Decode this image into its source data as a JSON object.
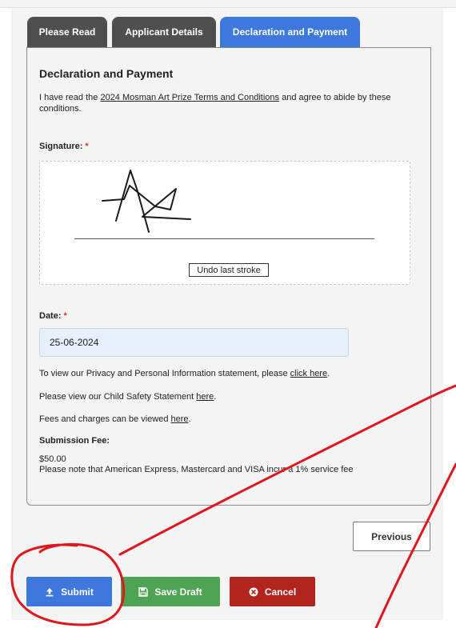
{
  "tabs": [
    {
      "label": "Please Read"
    },
    {
      "label": "Applicant Details"
    },
    {
      "label": "Declaration and Payment"
    }
  ],
  "declaration": {
    "heading": "Declaration and Payment",
    "text_before": "I have read the ",
    "terms_link": "2024 Mosman Art Prize Terms and Conditions",
    "text_after": " and agree to abide by these conditions."
  },
  "signature": {
    "label": "Signature:",
    "required_mark": "*",
    "undo_label": "Undo last stroke"
  },
  "date": {
    "label": "Date:",
    "required_mark": "*",
    "value": "25-06-2024"
  },
  "info": {
    "privacy_text": "To view our Privacy and Personal Information statement, please ",
    "privacy_link": "click here",
    "privacy_end": ".",
    "child_text": "Please view our Child Safety Statement ",
    "child_link": "here",
    "child_end": ".",
    "fees_text": "Fees and charges can be viewed ",
    "fees_link": "here",
    "fees_end": "."
  },
  "submission_fee": {
    "label": "Submission Fee:",
    "amount": "$50.00",
    "note": "Please note that American Express, Mastercard and VISA incur a 1% service fee"
  },
  "buttons": {
    "previous": "Previous",
    "submit": "Submit",
    "save_draft": "Save Draft",
    "cancel": "Cancel"
  },
  "colors": {
    "active_tab": "#3d79dc",
    "inactive_tab": "#4f4f4f",
    "submit": "#3d79dc",
    "save_draft": "#4ea452",
    "cancel": "#b1251c",
    "annotation": "#e0161e"
  },
  "icons": {
    "submit": "upload-icon",
    "save_draft": "floppy-disk-icon",
    "cancel": "close-circle-icon"
  }
}
